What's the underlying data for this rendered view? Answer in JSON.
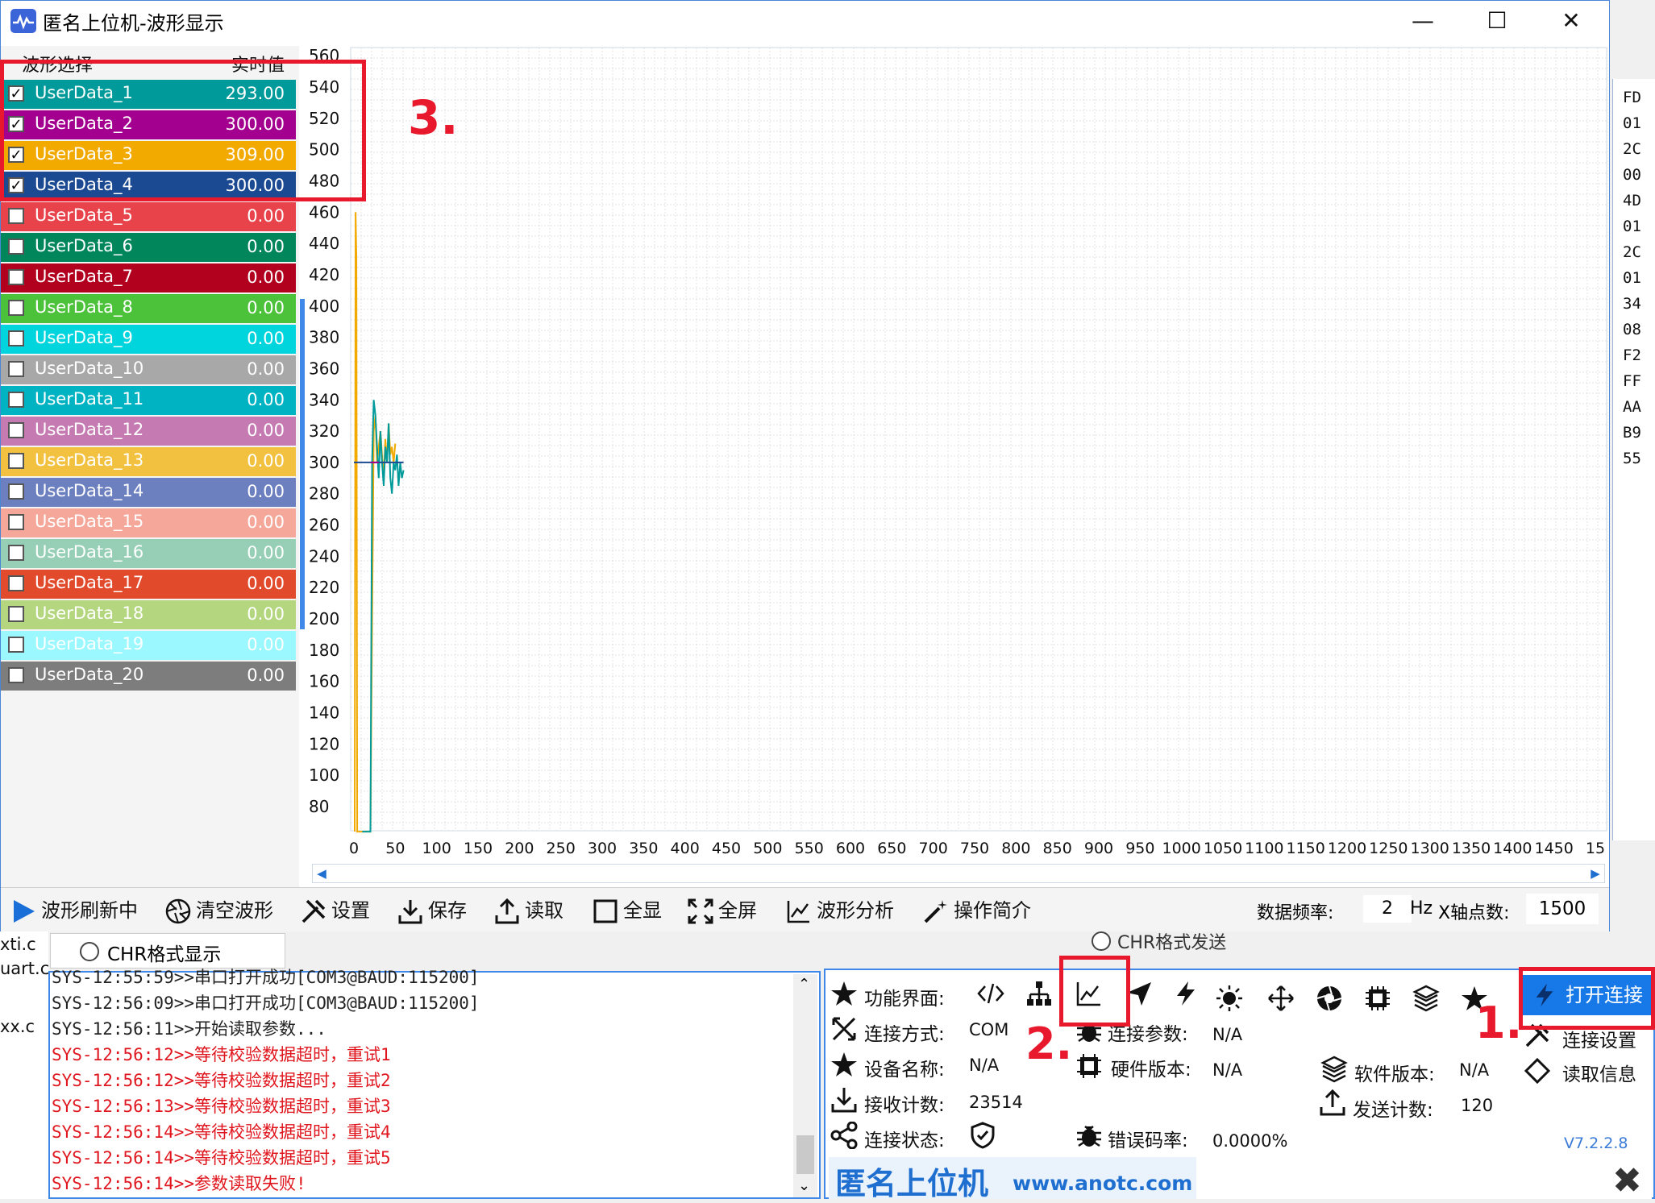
{
  "window": {
    "title": "匿名上位机-波形显示",
    "minimize": "—",
    "maximize": "☐",
    "close": "✕"
  },
  "list": {
    "header_select": "波形选择",
    "header_value": "实时值",
    "items": [
      {
        "name": "UserData_1",
        "value": "293.00",
        "checked": true,
        "color": "#009a9a"
      },
      {
        "name": "UserData_2",
        "value": "300.00",
        "checked": true,
        "color": "#a3008f"
      },
      {
        "name": "UserData_3",
        "value": "309.00",
        "checked": true,
        "color": "#f2a900"
      },
      {
        "name": "UserData_4",
        "value": "300.00",
        "checked": true,
        "color": "#1c4a92"
      },
      {
        "name": "UserData_5",
        "value": "0.00",
        "checked": false,
        "color": "#e8434b"
      },
      {
        "name": "UserData_6",
        "value": "0.00",
        "checked": false,
        "color": "#00865a"
      },
      {
        "name": "UserData_7",
        "value": "0.00",
        "checked": false,
        "color": "#b2001f"
      },
      {
        "name": "UserData_8",
        "value": "0.00",
        "checked": false,
        "color": "#4cc23a"
      },
      {
        "name": "UserData_9",
        "value": "0.00",
        "checked": false,
        "color": "#00d4dc"
      },
      {
        "name": "UserData_10",
        "value": "0.00",
        "checked": false,
        "color": "#a8a8a8"
      },
      {
        "name": "UserData_11",
        "value": "0.00",
        "checked": false,
        "color": "#00b3c3"
      },
      {
        "name": "UserData_12",
        "value": "0.00",
        "checked": false,
        "color": "#c57bb2"
      },
      {
        "name": "UserData_13",
        "value": "0.00",
        "checked": false,
        "color": "#f2c140"
      },
      {
        "name": "UserData_14",
        "value": "0.00",
        "checked": false,
        "color": "#6c7fbf"
      },
      {
        "name": "UserData_15",
        "value": "0.00",
        "checked": false,
        "color": "#f5a79a"
      },
      {
        "name": "UserData_16",
        "value": "0.00",
        "checked": false,
        "color": "#96cfb5"
      },
      {
        "name": "UserData_17",
        "value": "0.00",
        "checked": false,
        "color": "#e24a2c"
      },
      {
        "name": "UserData_18",
        "value": "0.00",
        "checked": false,
        "color": "#b3d67f"
      },
      {
        "name": "UserData_19",
        "value": "0.00",
        "checked": false,
        "color": "#9bf8ff"
      },
      {
        "name": "UserData_20",
        "value": "0.00",
        "checked": false,
        "color": "#7d7d7d"
      }
    ]
  },
  "chart_data": {
    "type": "line",
    "y_ticks": [
      560,
      540,
      520,
      500,
      480,
      460,
      440,
      420,
      400,
      380,
      360,
      340,
      320,
      300,
      280,
      260,
      240,
      220,
      200,
      180,
      160,
      140,
      120,
      100,
      80
    ],
    "x_ticks": [
      "0",
      "50",
      "100",
      "150",
      "200",
      "250",
      "300",
      "350",
      "400",
      "450",
      "500",
      "550",
      "600",
      "650",
      "700",
      "750",
      "800",
      "850",
      "900",
      "950",
      "1000",
      "1050",
      "1100",
      "1150",
      "1200",
      "1250",
      "1300",
      "1350",
      "1400",
      "1450",
      "15"
    ],
    "ylim": [
      64,
      562
    ],
    "xlim": [
      0,
      1500
    ],
    "series": [
      {
        "color": "#f2a900",
        "x": [
          1,
          2,
          3,
          4,
          5,
          6,
          7,
          8,
          9,
          10,
          11,
          12,
          14,
          16,
          18,
          20,
          22,
          24,
          26,
          28,
          30,
          32,
          34,
          36,
          38,
          40,
          42,
          44,
          46,
          48,
          50
        ],
        "y": [
          64,
          460,
          430,
          64,
          64,
          64,
          64,
          64,
          64,
          64,
          64,
          64,
          64,
          64,
          64,
          64,
          200,
          320,
          330,
          300,
          310,
          320,
          305,
          290,
          315,
          300,
          325,
          305,
          310,
          300,
          312
        ]
      },
      {
        "color": "#009a9a",
        "x": [
          10,
          12,
          14,
          16,
          18,
          20,
          22,
          24,
          26,
          28,
          30,
          32,
          34,
          36,
          38,
          40,
          42,
          44,
          46,
          48,
          50,
          52,
          54,
          56,
          58,
          60
        ],
        "y": [
          64,
          64,
          64,
          64,
          64,
          64,
          300,
          340,
          330,
          310,
          290,
          320,
          300,
          285,
          310,
          300,
          325,
          290,
          280,
          300,
          295,
          305,
          285,
          300,
          290,
          295
        ]
      },
      {
        "color": "#1c4a92",
        "x": [
          0,
          10,
          20,
          30,
          40,
          50,
          60
        ],
        "y": [
          300,
          300,
          300,
          300,
          300,
          300,
          300
        ]
      },
      {
        "color": "#a3008f",
        "x": [
          20,
          25,
          30
        ],
        "y": [
          300,
          300,
          300
        ]
      }
    ]
  },
  "toolbar": {
    "refresh": "波形刷新中",
    "clear": "清空波形",
    "settings": "设置",
    "save": "保存",
    "read": "读取",
    "fit": "全显",
    "fullscreen": "全屏",
    "analysis": "波形分析",
    "intro": "操作简介",
    "freq_label": "数据频率:",
    "freq_value": "2",
    "freq_unit": "Hz",
    "xpts_label": "X轴点数:",
    "xpts_value": "1500"
  },
  "hex": [
    "FD",
    "01",
    "2C",
    "00",
    "4D",
    "01",
    "2C",
    "01",
    "34",
    "08",
    "F2",
    "FF",
    "AA",
    "B9",
    "55"
  ],
  "files": [
    "xti.c",
    "uart.c",
    "xx.c"
  ],
  "chr_display": "CHR格式显示",
  "chr_send": "CHR格式发送",
  "log": [
    {
      "text": "SYS-12:55:59>>串口打开成功[COM3@BAUD:115200]",
      "color": "#222"
    },
    {
      "text": "SYS-12:56:09>>串口打开成功[COM3@BAUD:115200]",
      "color": "#222"
    },
    {
      "text": "SYS-12:56:11>>开始读取参数...",
      "color": "#222"
    },
    {
      "text": "SYS-12:56:12>>等待校验数据超时，重试1",
      "color": "#e0161e"
    },
    {
      "text": "SYS-12:56:12>>等待校验数据超时，重试2",
      "color": "#e0161e"
    },
    {
      "text": "SYS-12:56:13>>等待校验数据超时，重试3",
      "color": "#e0161e"
    },
    {
      "text": "SYS-12:56:14>>等待校验数据超时，重试4",
      "color": "#e0161e"
    },
    {
      "text": "SYS-12:56:14>>等待校验数据超时，重试5",
      "color": "#e0161e"
    },
    {
      "text": "SYS-12:56:14>>参数读取失败!",
      "color": "#e0161e"
    }
  ],
  "info": {
    "func_label": "功能界面:",
    "conn_mode_label": "连接方式:",
    "conn_mode_value": "COM",
    "conn_param_label": "连接参数:",
    "conn_param_value": "N/A",
    "conn_settings": "连接设置",
    "device_label": "设备名称:",
    "device_value": "N/A",
    "hw_label": "硬件版本:",
    "hw_value": "N/A",
    "sw_label": "软件版本:",
    "sw_value": "N/A",
    "read_info": "读取信息",
    "rx_label": "接收计数:",
    "rx_value": "23514",
    "tx_label": "发送计数:",
    "tx_value": "120",
    "state_label": "连接状态:",
    "err_label": "错误码率:",
    "err_value": "0.0000%",
    "connect_button": "打开连接",
    "version": "V7.2.2.8",
    "brand": "匿名上位机",
    "url": "www.anotc.com"
  },
  "annotations": {
    "n1": "1.",
    "n2": "2.",
    "n3": "3."
  }
}
